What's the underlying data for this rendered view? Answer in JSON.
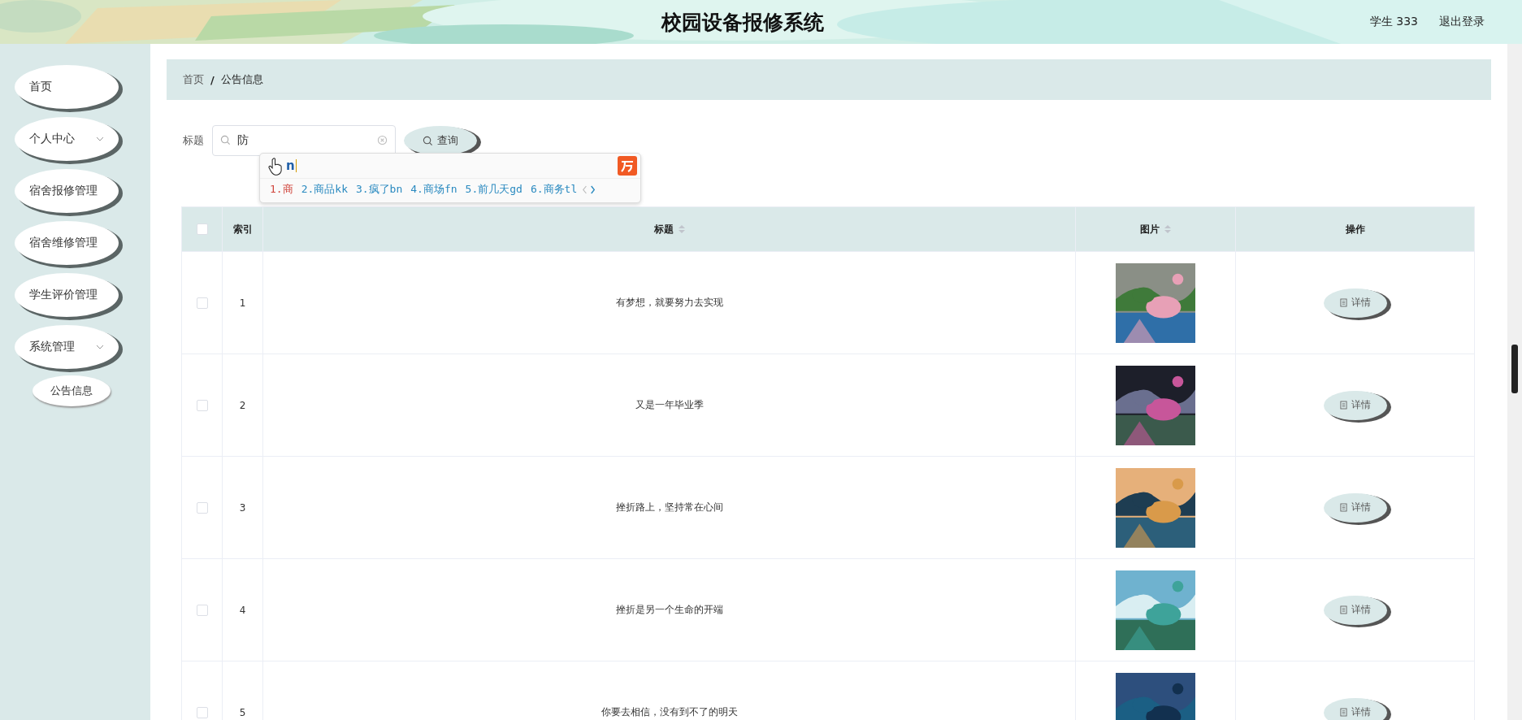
{
  "header": {
    "title": "校园设备报修系统",
    "user": "学生 333",
    "logout": "退出登录"
  },
  "sidebar": {
    "items": [
      {
        "label": "首页",
        "has_submenu": false
      },
      {
        "label": "个人中心",
        "has_submenu": true
      },
      {
        "label": "宿舍报修管理",
        "has_submenu": false
      },
      {
        "label": "宿舍维修管理",
        "has_submenu": false
      },
      {
        "label": "学生评价管理",
        "has_submenu": false
      },
      {
        "label": "系统管理",
        "has_submenu": true,
        "children": [
          {
            "label": "公告信息"
          }
        ]
      }
    ]
  },
  "breadcrumb": {
    "items": [
      "首页",
      "公告信息"
    ],
    "separator": "/"
  },
  "search": {
    "label": "标题",
    "value": "防",
    "button": "查询"
  },
  "ime": {
    "composition": "n",
    "candidates": [
      {
        "text": "1.商",
        "selected": true
      },
      {
        "text": "2.商品kk",
        "selected": false
      },
      {
        "text": "3.疯了bn",
        "selected": false
      },
      {
        "text": "4.商场fn",
        "selected": false
      },
      {
        "text": "5.前几天gd",
        "selected": false
      },
      {
        "text": "6.商务tl",
        "selected": false
      }
    ]
  },
  "table": {
    "select_all_checked": false,
    "columns": [
      {
        "kind": "checkbox",
        "sortable": false
      },
      {
        "kind": "text",
        "label": "索引",
        "sortable": false
      },
      {
        "kind": "text",
        "label": "标题",
        "sortable": true
      },
      {
        "kind": "text",
        "label": "图片",
        "sortable": true
      },
      {
        "kind": "text",
        "label": "操作",
        "sortable": false
      }
    ],
    "rows": [
      {
        "checked": false,
        "index": "1",
        "title": "有梦想，就要努力去实现",
        "action": "详情"
      },
      {
        "checked": false,
        "index": "2",
        "title": "又是一年毕业季",
        "action": "详情"
      },
      {
        "checked": false,
        "index": "3",
        "title": "挫折路上，坚持常在心间",
        "action": "详情"
      },
      {
        "checked": false,
        "index": "4",
        "title": "挫折是另一个生命的开端",
        "action": "详情"
      },
      {
        "checked": false,
        "index": "5",
        "title": "你要去相信，没有到不了的明天",
        "action": "详情"
      }
    ]
  }
}
